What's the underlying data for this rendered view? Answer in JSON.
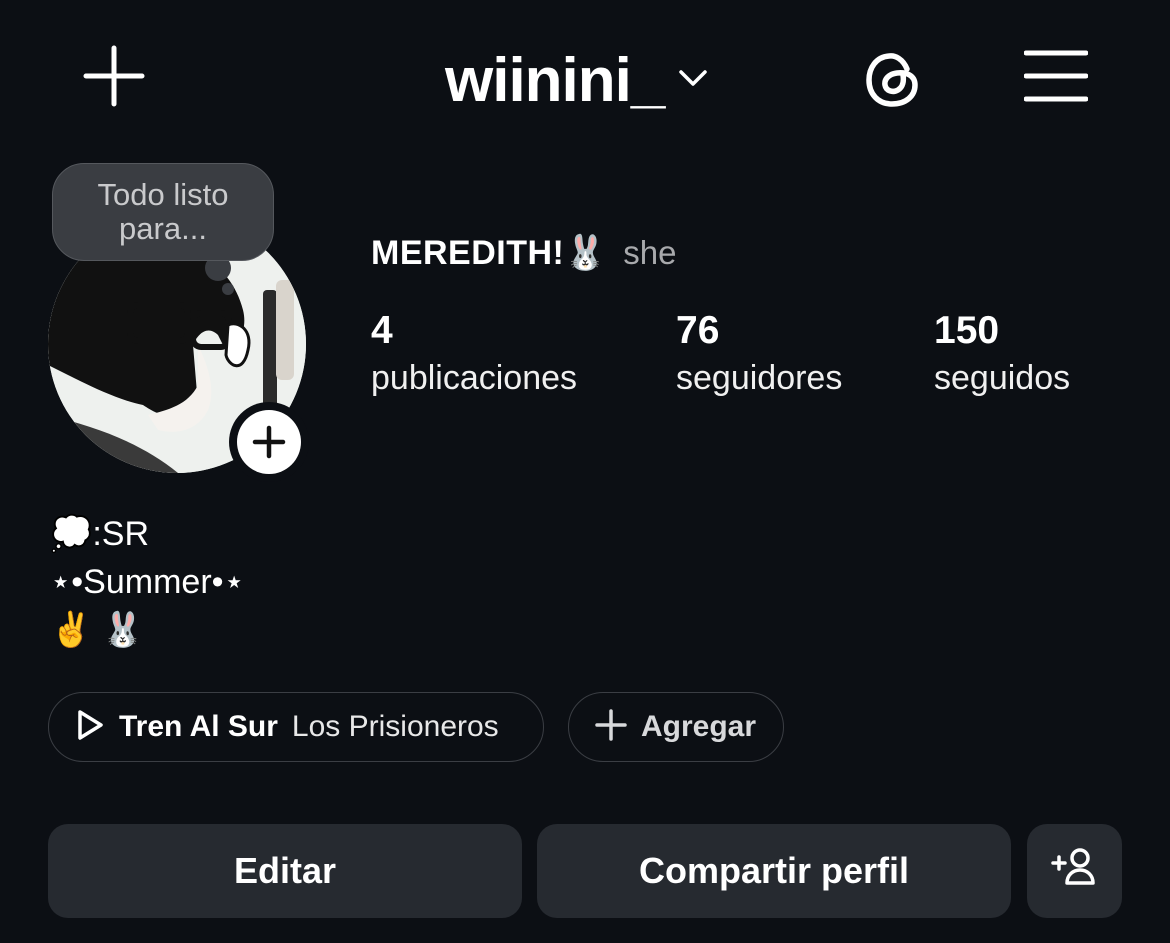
{
  "header": {
    "username": "wiinini_",
    "add_icon": "plus-icon",
    "threads_icon": "threads-icon",
    "menu_icon": "hamburger-menu-icon"
  },
  "profile": {
    "note": "Todo listo para...",
    "display_name": "MEREDITH!🐰",
    "pronouns": "she",
    "stats": [
      {
        "value": "4",
        "label": "publicaciones"
      },
      {
        "value": "76",
        "label": "seguidores"
      },
      {
        "value": "150",
        "label": "seguidos"
      }
    ],
    "bio": [
      "💭:SR",
      "⋆•Summer•⋆",
      "✌️ 🐰"
    ]
  },
  "music": {
    "song": "Tren Al Sur",
    "artist": "Los Prisioneros",
    "add_label": "Agregar"
  },
  "actions": {
    "edit_label": "Editar",
    "share_label": "Compartir perfil",
    "discover_icon": "add-person-icon"
  },
  "colors": {
    "background": "#0c0f14",
    "button": "#262a30",
    "secondary_text": "#a8a9ac"
  }
}
